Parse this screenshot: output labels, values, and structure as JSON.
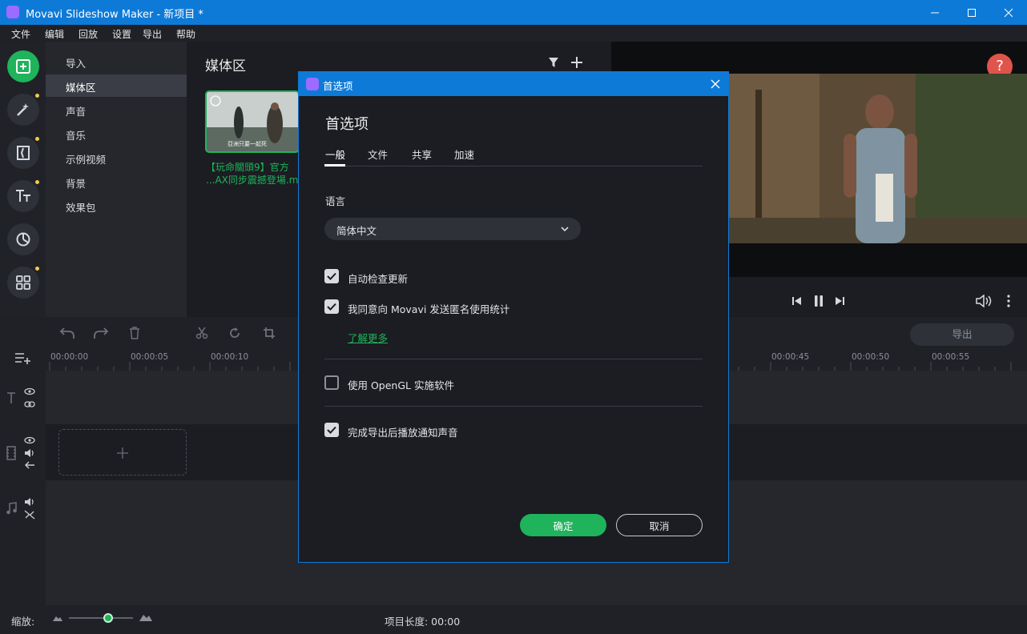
{
  "window": {
    "title": "Movavi Slideshow Maker - 新项目 *"
  },
  "menu": [
    "文件",
    "编辑",
    "回放",
    "设置",
    "导出",
    "帮助"
  ],
  "sidebar": {
    "items": [
      "导入",
      "媒体区",
      "声音",
      "音乐",
      "示例视频",
      "背景",
      "效果包"
    ],
    "active_index": 1
  },
  "media": {
    "title": "媒体区",
    "clip": {
      "line1": "【玩命關頭9】官方",
      "line2": "...AX同步震撼登場.m",
      "subtitle": "亞洲只要一起死"
    }
  },
  "player": {
    "help": "?"
  },
  "timeline": {
    "export_label": "导出",
    "ticks": [
      "00:00:00",
      "00:00:05",
      "00:00:10",
      "00:00:45",
      "00:00:50",
      "00:00:55"
    ]
  },
  "bottom": {
    "zoom_label": "缩放:",
    "project_length": "项目长度:  00:00"
  },
  "dialog": {
    "window_title": "首选项",
    "heading": "首选项",
    "tabs": [
      "一般",
      "文件",
      "共享",
      "加速"
    ],
    "active_tab": 0,
    "language_label": "语言",
    "language_value": "简体中文",
    "options": {
      "auto_update": {
        "label": "自动检查更新",
        "checked": true
      },
      "stats": {
        "label": "我同意向 Movavi 发送匿名使用统计",
        "checked": true
      },
      "learn_more": "了解更多",
      "opengl": {
        "label": "使用 OpenGL 实施软件",
        "checked": false
      },
      "sound": {
        "label": "完成导出后播放通知声音",
        "checked": true
      }
    },
    "ok": "确定",
    "cancel": "取消"
  },
  "colors": {
    "accent": "#0e7ad7",
    "green": "#1fb35b",
    "help": "#e0554b"
  }
}
